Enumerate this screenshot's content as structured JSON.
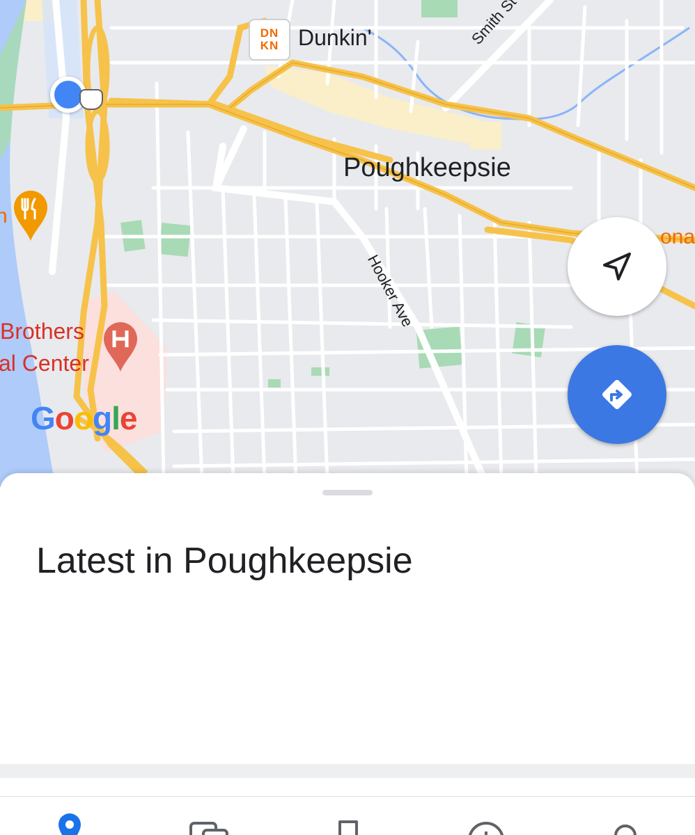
{
  "map": {
    "labels": {
      "dunkin": "Dunkin'",
      "smith_st": "Smith St",
      "city": "Poughkeepsie",
      "hooker_ave": "Hooker Ave",
      "brothers": "Brothers",
      "center": "al Center",
      "mcdonalds_partial": "onald",
      "restaurant_partial": "n"
    },
    "logo_text": "Google",
    "dunkin_logo": "DN KN"
  },
  "controls": {
    "locate_icon": "navigation-arrow-icon",
    "directions_icon": "directions-icon"
  },
  "sheet": {
    "title": "Latest in Poughkeepsie"
  },
  "bottom_nav": {
    "items": [
      {
        "icon": "explore-pin-icon",
        "active": true
      },
      {
        "icon": "commute-icon",
        "active": false
      },
      {
        "icon": "saved-icon",
        "active": false
      },
      {
        "icon": "contribute-icon",
        "active": false
      },
      {
        "icon": "updates-icon",
        "active": false
      }
    ]
  },
  "colors": {
    "highway": "#f6c24a",
    "road": "#ffffff",
    "water": "#aecbfa",
    "park": "#a8dab5",
    "accent": "#3c78e3",
    "hospital": "#d93025"
  }
}
